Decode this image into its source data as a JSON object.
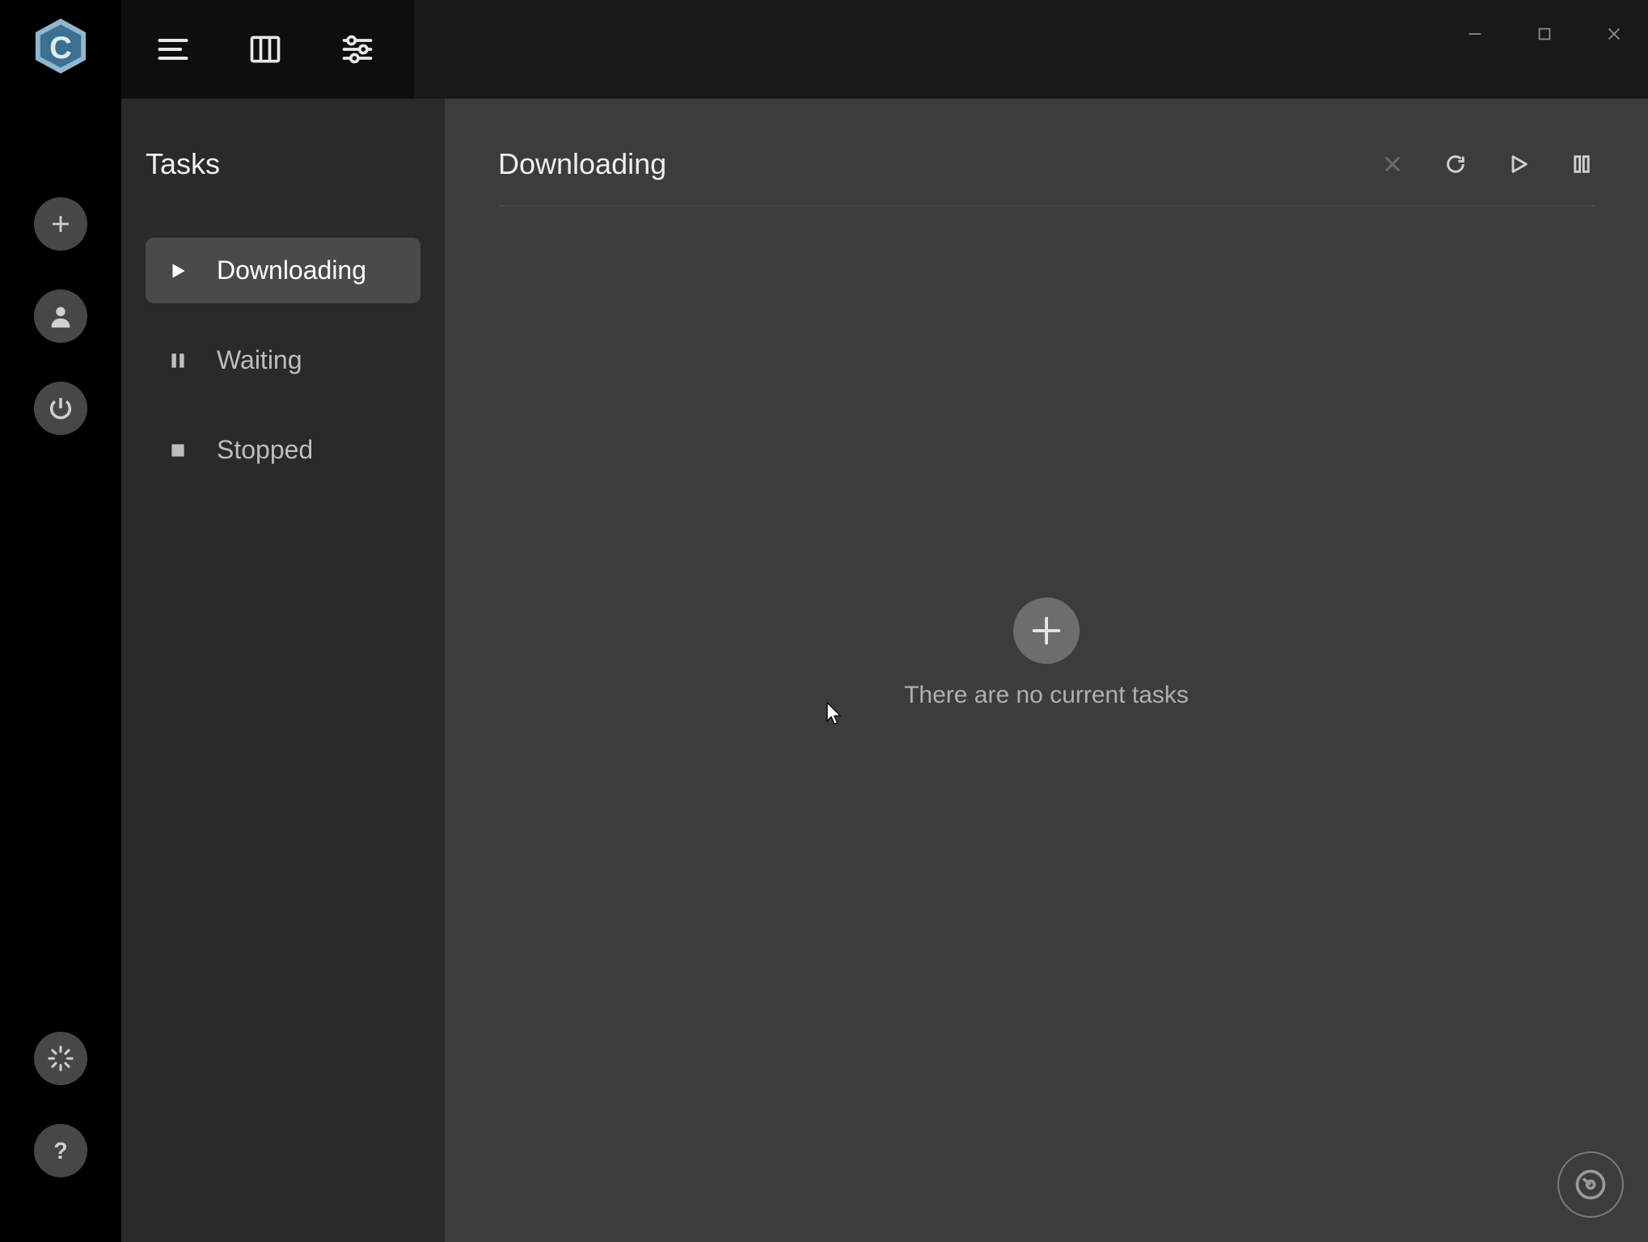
{
  "sidebar": {
    "title": "Tasks",
    "items": [
      {
        "label": "Downloading",
        "icon": "play",
        "active": true
      },
      {
        "label": "Waiting",
        "icon": "pause",
        "active": false
      },
      {
        "label": "Stopped",
        "icon": "stop",
        "active": false
      }
    ]
  },
  "content": {
    "title": "Downloading",
    "empty_text": "There are no current tasks"
  },
  "header_actions": {
    "cancel": "cancel",
    "refresh": "refresh",
    "play": "play",
    "pause": "pause"
  },
  "topbar": {
    "menu": "menu",
    "film": "film",
    "sliders": "settings-sliders"
  },
  "rail": {
    "add": "add",
    "user": "user",
    "power": "power",
    "spinner": "loading",
    "help": "help"
  },
  "window": {
    "minimize": "minimize",
    "maximize": "maximize",
    "close": "close"
  },
  "float": {
    "speed": "speedometer"
  }
}
